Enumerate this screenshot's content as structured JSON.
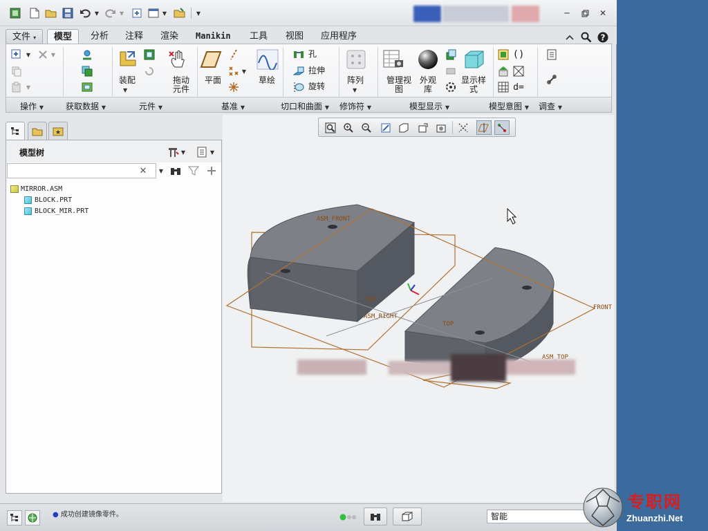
{
  "colors": {
    "desktop": "#3b6a9c",
    "datum_plane": "#b07030",
    "part_face_top": "#7d8187",
    "part_face_side": "#5d6167",
    "status_green": "#2fc13c"
  },
  "quick_access": {
    "icons": [
      "new-icon",
      "open-icon",
      "save-icon",
      "undo-icon",
      "redo-icon",
      "regenerate-icon",
      "windows-icon",
      "close-window-icon",
      "customize-icon"
    ]
  },
  "window_controls": [
    "minimize",
    "maximize",
    "close"
  ],
  "tabs": [
    {
      "label": "文件",
      "caret": "▾"
    },
    {
      "label": "模型"
    },
    {
      "label": "分析"
    },
    {
      "label": "注释"
    },
    {
      "label": "渲染"
    },
    {
      "label": "Manikin"
    },
    {
      "label": "工具"
    },
    {
      "label": "视图"
    },
    {
      "label": "应用程序"
    }
  ],
  "ribbon": {
    "groups": [
      {
        "label": "操作"
      },
      {
        "label": "获取数据"
      },
      {
        "label": "元件"
      },
      {
        "label": "基准"
      },
      {
        "label": "切口和曲面"
      },
      {
        "label": "修饰符"
      },
      {
        "label": "模型显示"
      },
      {
        "label": "模型意图"
      },
      {
        "label": "调查"
      }
    ],
    "buttons": {
      "assemble": "装配",
      "drag_component": "拖动\n元件",
      "plane": "平面",
      "sketch": "草绘",
      "hole": "孔",
      "extrude": "拉伸",
      "revolve": "旋转",
      "pattern": "阵列",
      "manage_views": "管理视\n图",
      "appearance": "外观\n库",
      "display_style": "显示样\n式"
    }
  },
  "model_tree": {
    "title": "模型树",
    "search_value": "",
    "items": [
      {
        "name": "MIRROR.ASM",
        "type": "assembly"
      },
      {
        "name": "BLOCK.PRT",
        "type": "part"
      },
      {
        "name": "BLOCK_MIR.PRT",
        "type": "part"
      }
    ]
  },
  "graphics": {
    "datum_labels": {
      "asm_front": "ASM_FRONT",
      "top_left": "TOP",
      "asm_right": "ASM_RIGHT",
      "top_right": "TOP",
      "front_right": "FRONT",
      "asm_top": "ASM_TOP"
    }
  },
  "statusbar": {
    "message": "成功创建镜像零件。",
    "selection_filter": "智能"
  },
  "watermark": {
    "text": "专职网",
    "url": "Zhuanzhi.Net"
  }
}
